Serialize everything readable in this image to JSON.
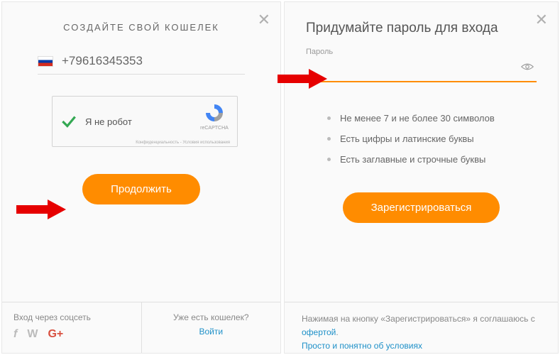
{
  "left": {
    "heading": "СОЗДАЙТЕ СВОЙ КОШЕЛЕК",
    "phone": "+79616345353",
    "recaptcha_label": "Я не робот",
    "recaptcha_brand": "reCAPTCHA",
    "recaptcha_privacy": "Конфиденциальность - Условия использования",
    "continue_btn": "Продолжить",
    "social_heading": "Вход через соцсеть",
    "already_have": "Уже есть кошелек?",
    "login": "Войти"
  },
  "right": {
    "heading": "Придумайте пароль для входа",
    "password_label": "Пароль",
    "rules": {
      "r1": "Не менее 7 и не более 30 символов",
      "r2": "Есть цифры и латинские буквы",
      "r3": "Есть заглавные и строчные буквы"
    },
    "register_btn": "Зарегистрироваться",
    "footer_text_1": "Нажимая на кнопку «Зарегистрироваться» я соглашаюсь с ",
    "offer_link": "офертой",
    "footer_dot": ".",
    "footer_text_2": "Просто и понятно об условиях"
  },
  "icons": {
    "close": "close-icon",
    "flag": "flag-ru-icon",
    "check": "check-icon",
    "recaptcha": "recaptcha-icon",
    "eye": "eye-icon",
    "facebook": "facebook-icon",
    "vk": "vk-icon",
    "google": "google-plus-icon",
    "arrow": "red-arrow-icon"
  }
}
